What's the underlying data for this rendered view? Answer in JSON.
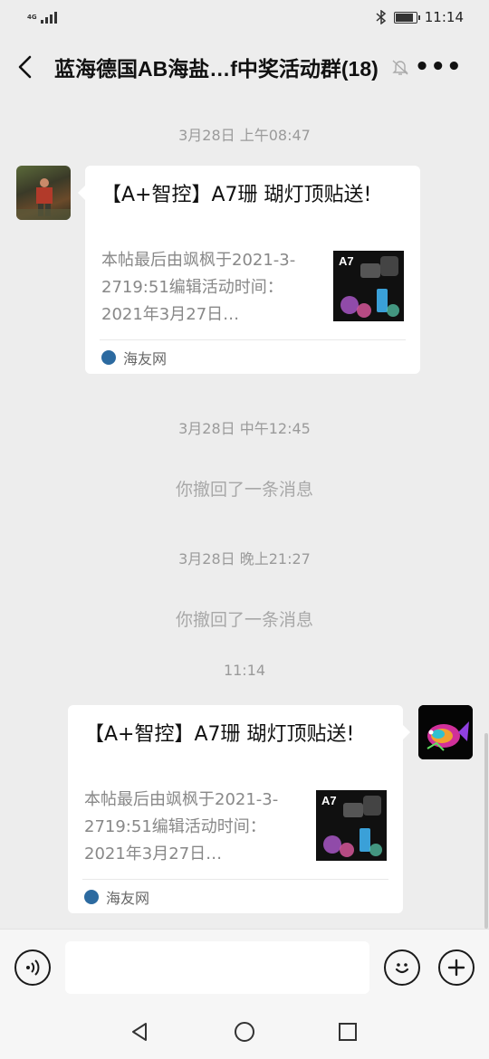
{
  "status_bar": {
    "network": "4G",
    "time": "11:14"
  },
  "header": {
    "title": "蓝海德国AB海盐…f中奖活动群(18)"
  },
  "messages": {
    "time1": "3月28日 上午08:47",
    "card1": {
      "title": "【A+智控】A7珊 瑚灯顶贴送!",
      "desc": "本帖最后由飒枫于2021-3-2719:51编辑活动时间：2021年3月27日…",
      "thumb_label": "A7",
      "source": "海友网"
    },
    "time2": "3月28日 中午12:45",
    "recall1": "你撤回了一条消息",
    "time3": "3月28日 晚上21:27",
    "recall2": "你撤回了一条消息",
    "time4": "11:14",
    "card2": {
      "title": "【A+智控】A7珊 瑚灯顶贴送!",
      "desc": "本帖最后由飒枫于2021-3-2719:51编辑活动时间：2021年3月27日…",
      "thumb_label": "A7",
      "source": "海友网"
    }
  },
  "input_bar": {
    "placeholder": ""
  },
  "colors": {
    "background": "#ededed",
    "bubble": "#ffffff",
    "muted_text": "#9a9a9a"
  }
}
